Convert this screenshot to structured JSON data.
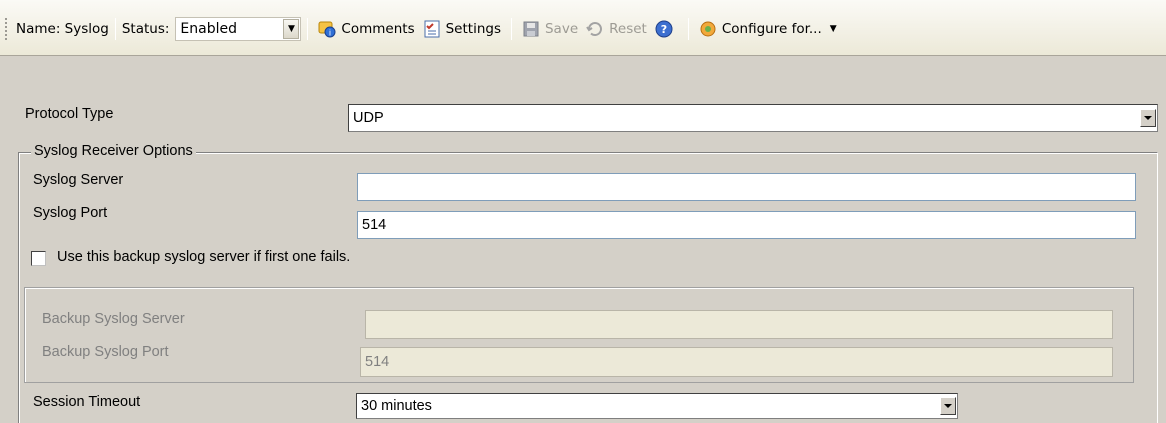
{
  "toolbar": {
    "name_label": "Name: Syslog",
    "status_label": "Status:",
    "status_value": "Enabled",
    "comments_label": "Comments",
    "settings_label": "Settings",
    "save_label": "Save",
    "reset_label": "Reset",
    "configure_label": "Configure for..."
  },
  "form": {
    "protocol_type_label": "Protocol Type",
    "protocol_type_value": "UDP",
    "receiver_group_title": "Syslog Receiver Options",
    "syslog_server_label": "Syslog Server",
    "syslog_server_value": "",
    "syslog_port_label": "Syslog Port",
    "syslog_port_value": "514",
    "backup_checkbox_label": "Use this backup syslog server if first one fails.",
    "backup_server_label": "Backup Syslog Server",
    "backup_server_value": "",
    "backup_port_label": "Backup Syslog Port",
    "backup_port_value": "514",
    "session_timeout_label": "Session Timeout",
    "session_timeout_value": "30 minutes"
  }
}
